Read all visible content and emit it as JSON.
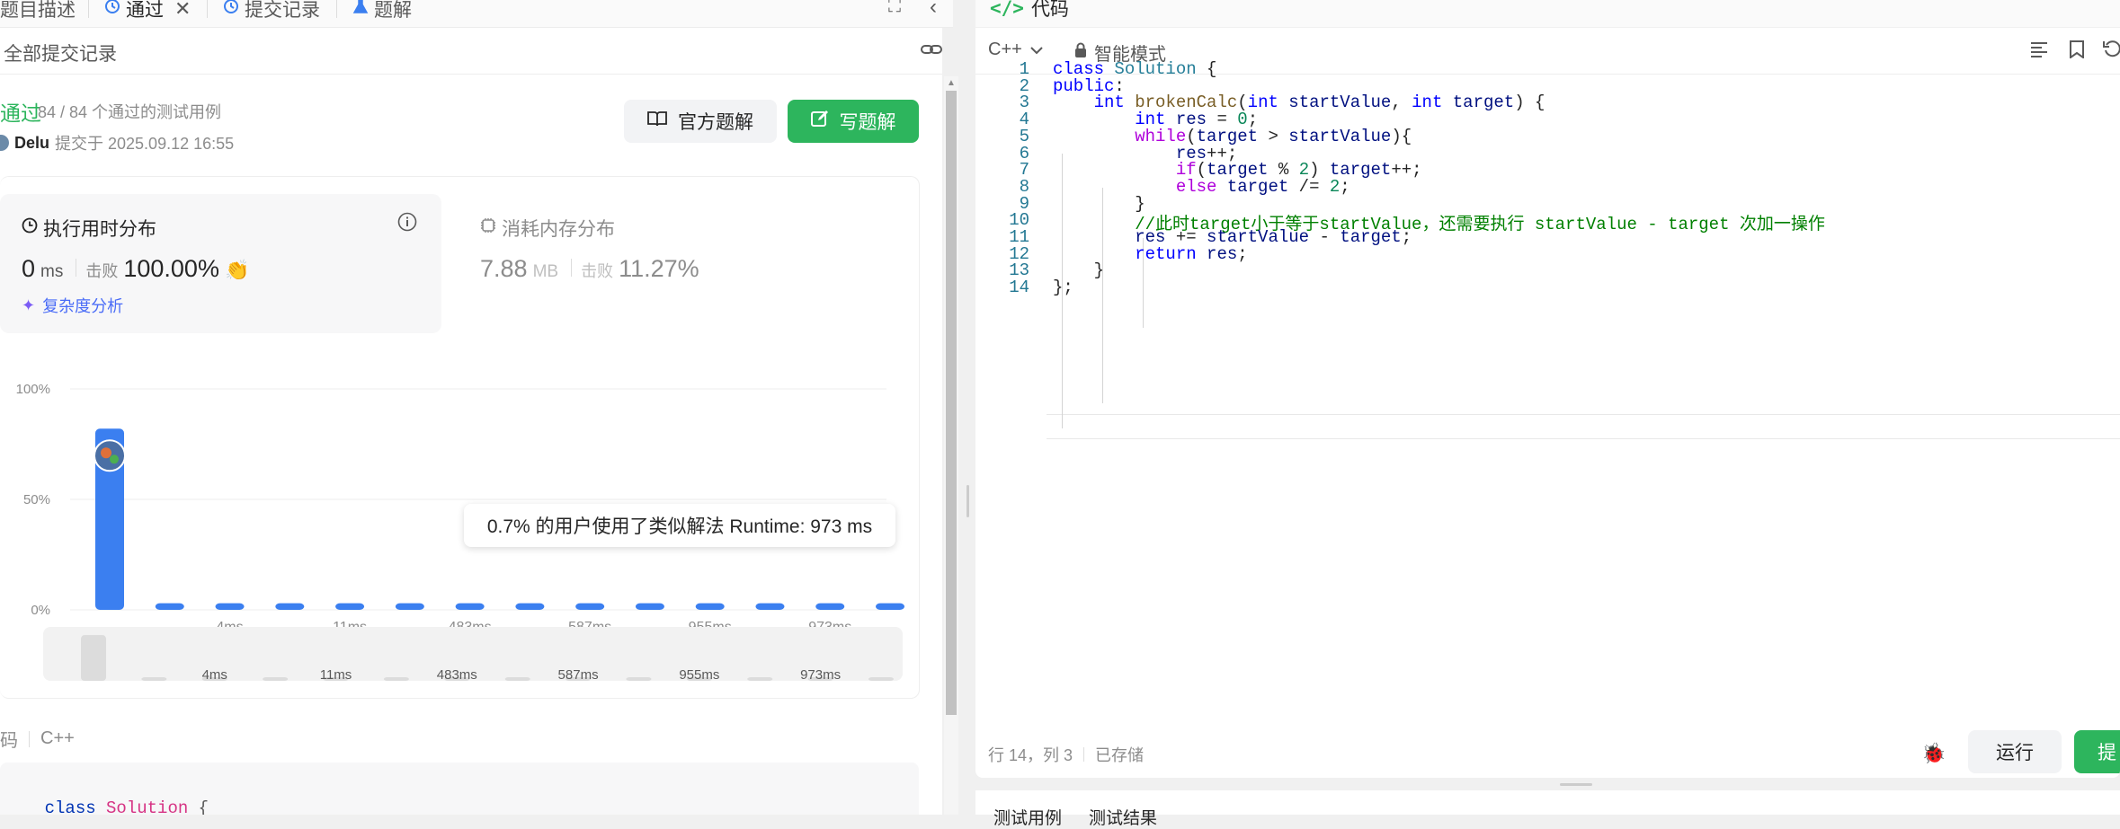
{
  "left_tabs": [
    {
      "label": "题目描述"
    },
    {
      "label": "通过"
    },
    {
      "label": "提交记录"
    },
    {
      "label": "题解"
    }
  ],
  "submission": {
    "header_title": "全部提交记录",
    "status": "通过",
    "testcases": "84 / 84 个通过的测试用例",
    "user": "Delu",
    "submitted_at": "提交于 2025.09.12 16:55",
    "official_solution_label": "官方题解",
    "write_solution_label": "写题解"
  },
  "runtime": {
    "title": "执行用时分布",
    "value": "0",
    "unit": "ms",
    "beats_label": "击败",
    "beats_value": "100.00%",
    "complexity_link": "复杂度分析"
  },
  "memory": {
    "title": "消耗内存分布",
    "value": "7.88",
    "unit": "MB",
    "beats_label": "击败",
    "beats_value": "11.27%"
  },
  "tooltip_text": "0.7% 的用户使用了类似解法 Runtime: 973 ms",
  "chart_data": {
    "type": "bar",
    "title": "",
    "xlabel": "",
    "ylabel": "",
    "y_ticks": [
      "100%",
      "50%",
      "0%"
    ],
    "ylim": [
      0,
      100
    ],
    "x_tick_labels": [
      "4ms",
      "11ms",
      "483ms",
      "587ms",
      "955ms",
      "973ms"
    ],
    "values": [
      82,
      3,
      3,
      3,
      3,
      3,
      3,
      3,
      3,
      3,
      3,
      3,
      3,
      3
    ],
    "highlight_index": 0,
    "bar_color": "#3b7ff0",
    "grid": true
  },
  "left_code": {
    "label": "码",
    "lang": "C++",
    "first_line": "class Solution {"
  },
  "right_tab": {
    "label": "代码"
  },
  "editor": {
    "language": "C++",
    "mode": "智能模式",
    "status_position": "行 14，列 3",
    "status_saved": "已存储",
    "run_label": "运行",
    "submit_label": "提"
  },
  "code_lines": [
    "class Solution {",
    "public:",
    "    int brokenCalc(int startValue, int target) {",
    "        int res = 0;",
    "        while(target > startValue){",
    "            res++;",
    "            if(target % 2) target++;",
    "            else target /= 2;",
    "        }",
    "        //此时target小于等于startValue，还需要执行 startValue - target 次加一操作",
    "        res += startValue - target;",
    "        return res;",
    "    }",
    "};"
  ],
  "bottom_tabs": [
    {
      "label": "测试用例"
    },
    {
      "label": "测试结果"
    }
  ],
  "colors": {
    "accent_green": "#2db55d",
    "accent_blue": "#3b7ff0",
    "link_blue": "#4a6cf7"
  }
}
